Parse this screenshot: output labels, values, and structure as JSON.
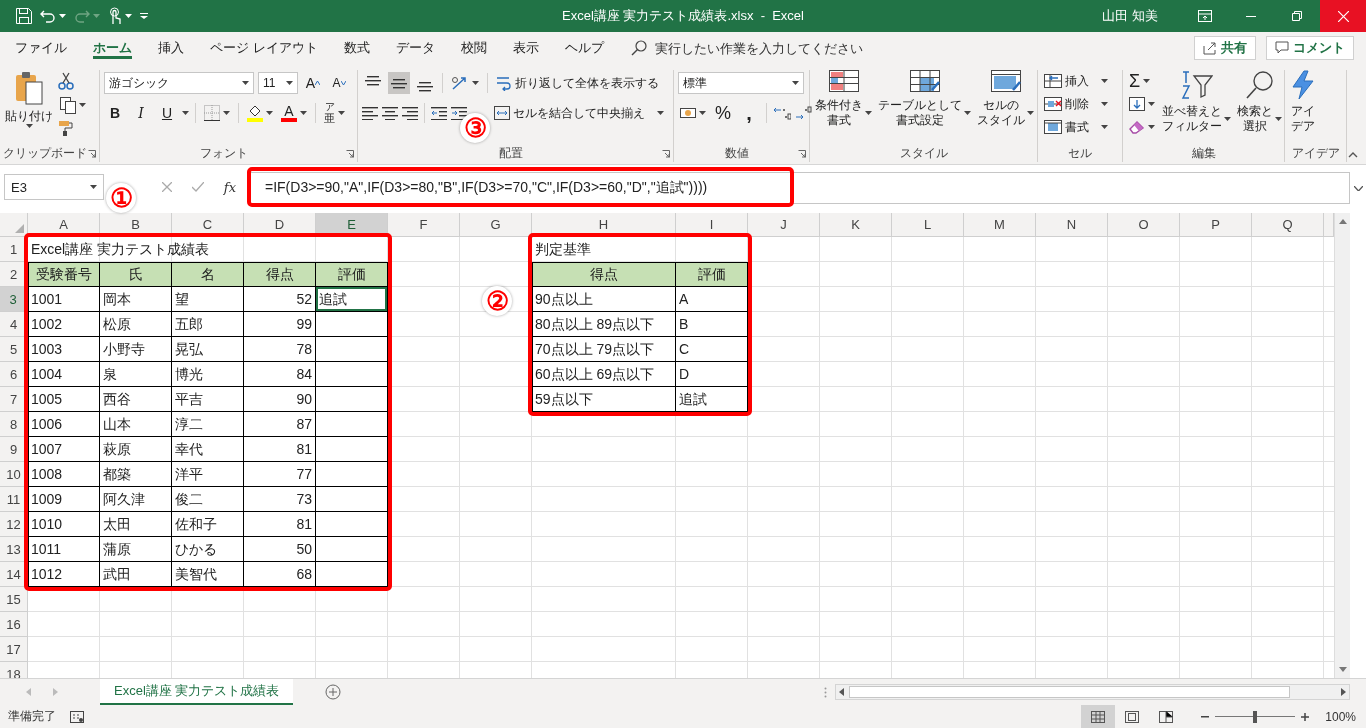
{
  "title_bar": {
    "title": "Excel講座 実力テスト成績表.xlsx  -  Excel",
    "user": "山田 知美"
  },
  "menu_tabs": [
    {
      "label": "ファイル",
      "selected": false
    },
    {
      "label": "ホーム",
      "selected": true
    },
    {
      "label": "挿入",
      "selected": false
    },
    {
      "label": "ページ レイアウト",
      "selected": false
    },
    {
      "label": "数式",
      "selected": false
    },
    {
      "label": "データ",
      "selected": false
    },
    {
      "label": "校閲",
      "selected": false
    },
    {
      "label": "表示",
      "selected": false
    },
    {
      "label": "ヘルプ",
      "selected": false
    }
  ],
  "tell_me": {
    "placeholder": "実行したい作業を入力してください"
  },
  "share_button": "共有",
  "comment_button": "コメント",
  "ribbon_groups": [
    {
      "kind": "clipboard",
      "label": "クリップボード",
      "paste": "貼り付け"
    },
    {
      "kind": "font",
      "label": "フォント",
      "font_name": "游ゴシック",
      "font_size": "11",
      "grow": "A",
      "shrink": "A",
      "styles": [
        "B",
        "I",
        "U"
      ],
      "font_color": "A",
      "phonetic": "亜",
      "phonetic_ruby": "ア"
    },
    {
      "kind": "alignment",
      "label": "配置",
      "vertical": [
        {
          "selected": false
        },
        {
          "selected": true
        },
        {
          "selected": false
        }
      ],
      "wrap_text": "折り返して全体を表示する",
      "merge": "セルを結合して中央揃え"
    },
    {
      "kind": "number",
      "label": "数値",
      "format": "標準",
      "percent": "%",
      "comma": ","
    },
    {
      "kind": "styles",
      "label": "スタイル",
      "buttons": [
        {
          "lines": [
            "条件付き",
            "書式"
          ]
        },
        {
          "lines": [
            "テーブルとして",
            "書式設定"
          ]
        },
        {
          "lines": [
            "セルの",
            "スタイル"
          ]
        }
      ]
    },
    {
      "kind": "cells",
      "label": "セル",
      "buttons": [
        "挿入",
        "削除",
        "書式"
      ]
    },
    {
      "kind": "editing",
      "label": "編集",
      "autosum": "Σ",
      "buttons": [
        {
          "lines": [
            "並べ替えと",
            "フィルター"
          ]
        },
        {
          "lines": [
            "検索と",
            "選択"
          ]
        }
      ]
    },
    {
      "kind": "ideas",
      "label": "アイデア",
      "button": {
        "lines": [
          "アイ",
          "デア"
        ]
      }
    }
  ],
  "formula_bar": {
    "name_box": "E3",
    "fx": "fx",
    "formula": "=IF(D3>=90,\"A\",IF(D3>=80,\"B\",IF(D3>=70,\"C\",IF(D3>=60,\"D\",\"追試\"))))",
    "highlighted": true,
    "callout": "③"
  },
  "sheet": {
    "columns": [
      {
        "label": "A",
        "selected": false
      },
      {
        "label": "B",
        "selected": false
      },
      {
        "label": "C",
        "selected": false
      },
      {
        "label": "D",
        "selected": false
      },
      {
        "label": "E",
        "selected": true
      },
      {
        "label": "F",
        "selected": false
      },
      {
        "label": "G",
        "selected": false
      },
      {
        "label": "H",
        "selected": false
      },
      {
        "label": "I",
        "selected": false
      },
      {
        "label": "J",
        "selected": false
      },
      {
        "label": "K",
        "selected": false
      },
      {
        "label": "L",
        "selected": false
      },
      {
        "label": "M",
        "selected": false
      },
      {
        "label": "N",
        "selected": false
      },
      {
        "label": "O",
        "selected": false
      },
      {
        "label": "P",
        "selected": false
      },
      {
        "label": "Q",
        "selected": false
      }
    ],
    "rows": [
      {
        "label": "1",
        "selected": false,
        "cells": [
          {
            "kind": "title",
            "text": "Excel講座 実力テスト成績表"
          },
          {
            "kind": "empty"
          },
          {
            "kind": "empty"
          },
          {
            "kind": "empty"
          },
          {
            "kind": "empty"
          },
          {
            "kind": "empty"
          },
          {
            "kind": "empty"
          },
          {
            "kind": "title",
            "text": "判定基準"
          }
        ]
      },
      {
        "label": "2",
        "selected": false,
        "cells": [
          {
            "kind": "header",
            "text": "受験番号"
          },
          {
            "kind": "header",
            "text": "氏"
          },
          {
            "kind": "header",
            "text": "名"
          },
          {
            "kind": "header",
            "text": "得点"
          },
          {
            "kind": "header",
            "text": "評価"
          },
          {
            "kind": "empty"
          },
          {
            "kind": "empty"
          },
          {
            "kind": "header",
            "text": "得点"
          },
          {
            "kind": "header",
            "text": "評価"
          }
        ]
      },
      {
        "label": "3",
        "selected": true,
        "cells": [
          {
            "kind": "text",
            "text": "1001"
          },
          {
            "kind": "text",
            "text": "岡本"
          },
          {
            "kind": "text",
            "text": "望"
          },
          {
            "kind": "number",
            "text": "52"
          },
          {
            "kind": "text",
            "text": "追試"
          },
          {
            "kind": "empty"
          },
          {
            "kind": "empty"
          },
          {
            "kind": "text",
            "text": "90点以上"
          },
          {
            "kind": "text",
            "text": "A"
          }
        ]
      },
      {
        "label": "4",
        "selected": false,
        "cells": [
          {
            "kind": "text",
            "text": "1002"
          },
          {
            "kind": "text",
            "text": "松原"
          },
          {
            "kind": "text",
            "text": "五郎"
          },
          {
            "kind": "number",
            "text": "99"
          },
          {
            "kind": "blank"
          },
          {
            "kind": "empty"
          },
          {
            "kind": "empty"
          },
          {
            "kind": "text",
            "text": "80点以上 89点以下"
          },
          {
            "kind": "text",
            "text": "B"
          }
        ]
      },
      {
        "label": "5",
        "selected": false,
        "cells": [
          {
            "kind": "text",
            "text": "1003"
          },
          {
            "kind": "text",
            "text": "小野寺"
          },
          {
            "kind": "text",
            "text": "晃弘"
          },
          {
            "kind": "number",
            "text": "78"
          },
          {
            "kind": "blank"
          },
          {
            "kind": "empty"
          },
          {
            "kind": "empty"
          },
          {
            "kind": "text",
            "text": "70点以上 79点以下"
          },
          {
            "kind": "text",
            "text": "C"
          }
        ]
      },
      {
        "label": "6",
        "selected": false,
        "cells": [
          {
            "kind": "text",
            "text": "1004"
          },
          {
            "kind": "text",
            "text": "泉"
          },
          {
            "kind": "text",
            "text": "博光"
          },
          {
            "kind": "number",
            "text": "84"
          },
          {
            "kind": "blank"
          },
          {
            "kind": "empty"
          },
          {
            "kind": "empty"
          },
          {
            "kind": "text",
            "text": "60点以上 69点以下"
          },
          {
            "kind": "text",
            "text": "D"
          }
        ]
      },
      {
        "label": "7",
        "selected": false,
        "cells": [
          {
            "kind": "text",
            "text": "1005"
          },
          {
            "kind": "text",
            "text": "西谷"
          },
          {
            "kind": "text",
            "text": "平吉"
          },
          {
            "kind": "number",
            "text": "90"
          },
          {
            "kind": "blank"
          },
          {
            "kind": "empty"
          },
          {
            "kind": "empty"
          },
          {
            "kind": "text",
            "text": "59点以下"
          },
          {
            "kind": "text",
            "text": "追試"
          }
        ]
      },
      {
        "label": "8",
        "selected": false,
        "cells": [
          {
            "kind": "text",
            "text": "1006"
          },
          {
            "kind": "text",
            "text": "山本"
          },
          {
            "kind": "text",
            "text": "淳二"
          },
          {
            "kind": "number",
            "text": "87"
          },
          {
            "kind": "blank"
          }
        ]
      },
      {
        "label": "9",
        "selected": false,
        "cells": [
          {
            "kind": "text",
            "text": "1007"
          },
          {
            "kind": "text",
            "text": "萩原"
          },
          {
            "kind": "text",
            "text": "幸代"
          },
          {
            "kind": "number",
            "text": "81"
          },
          {
            "kind": "blank"
          }
        ]
      },
      {
        "label": "10",
        "selected": false,
        "cells": [
          {
            "kind": "text",
            "text": "1008"
          },
          {
            "kind": "text",
            "text": "都築"
          },
          {
            "kind": "text",
            "text": "洋平"
          },
          {
            "kind": "number",
            "text": "77"
          },
          {
            "kind": "blank"
          }
        ]
      },
      {
        "label": "11",
        "selected": false,
        "cells": [
          {
            "kind": "text",
            "text": "1009"
          },
          {
            "kind": "text",
            "text": "阿久津"
          },
          {
            "kind": "text",
            "text": "俊二"
          },
          {
            "kind": "number",
            "text": "73"
          },
          {
            "kind": "blank"
          }
        ]
      },
      {
        "label": "12",
        "selected": false,
        "cells": [
          {
            "kind": "text",
            "text": "1010"
          },
          {
            "kind": "text",
            "text": "太田"
          },
          {
            "kind": "text",
            "text": "佐和子"
          },
          {
            "kind": "number",
            "text": "81"
          },
          {
            "kind": "blank"
          }
        ]
      },
      {
        "label": "13",
        "selected": false,
        "cells": [
          {
            "kind": "text",
            "text": "1011"
          },
          {
            "kind": "text",
            "text": "蒲原"
          },
          {
            "kind": "text",
            "text": "ひかる"
          },
          {
            "kind": "number",
            "text": "50"
          },
          {
            "kind": "blank"
          }
        ]
      },
      {
        "label": "14",
        "selected": false,
        "cells": [
          {
            "kind": "text",
            "text": "1012"
          },
          {
            "kind": "text",
            "text": "武田"
          },
          {
            "kind": "text",
            "text": "美智代"
          },
          {
            "kind": "number",
            "text": "68"
          },
          {
            "kind": "blank"
          }
        ]
      },
      {
        "label": "15",
        "selected": false
      },
      {
        "label": "16",
        "selected": false
      },
      {
        "label": "17",
        "selected": false
      },
      {
        "label": "18",
        "selected": false
      }
    ],
    "highlight_frames": [
      {
        "callout": "①"
      },
      {
        "callout": "②"
      }
    ]
  },
  "sheet_tabs": [
    {
      "label": "Excel講座 実力テスト成績表",
      "selected": true
    }
  ],
  "status_bar": {
    "text": "準備完了",
    "views": [
      {
        "selected": true
      },
      {
        "selected": false
      },
      {
        "selected": false
      }
    ],
    "zoom": {
      "level": 0.5,
      "reading": "100%"
    }
  }
}
